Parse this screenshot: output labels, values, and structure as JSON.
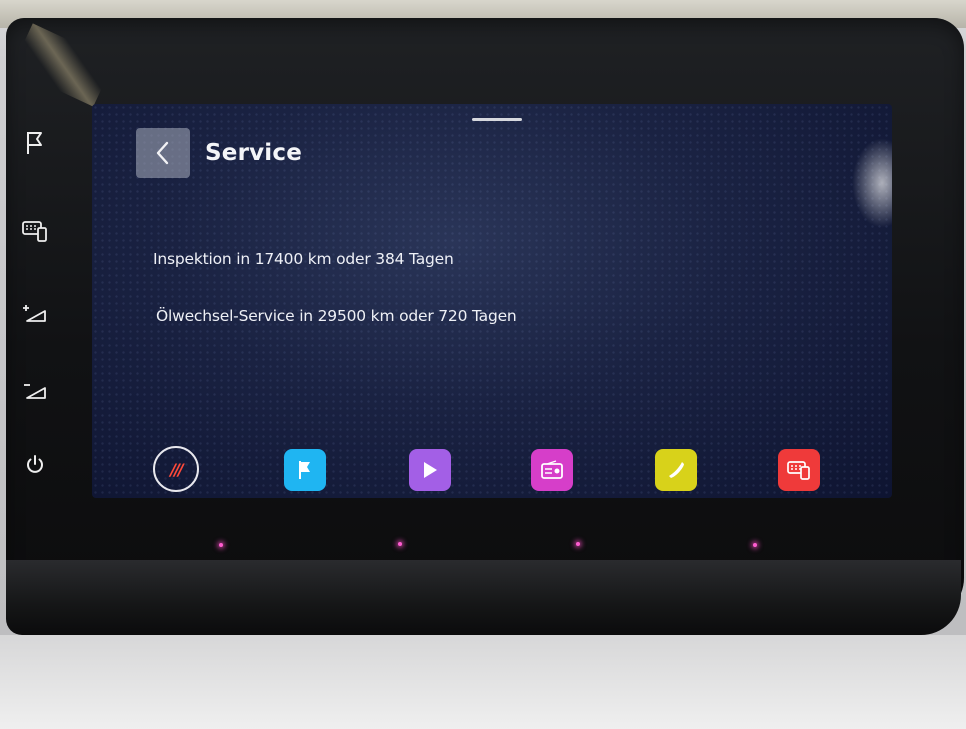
{
  "header": {
    "title": "Service"
  },
  "service_lines": [
    "Inspektion in 17400 km oder 384 Tagen",
    "Ölwechsel-Service in 29500 km oder 720 Tagen"
  ],
  "dock": {
    "home_label": "///",
    "items": [
      {
        "icon": "flag-icon",
        "color": "#1fb5f2"
      },
      {
        "icon": "play-icon",
        "color": "#a35fe6"
      },
      {
        "icon": "radio-icon",
        "color": "#d63ec9"
      },
      {
        "icon": "phone-icon",
        "color": "#d8d21a"
      },
      {
        "icon": "car-phone-icon",
        "color": "#ef3a3a"
      }
    ]
  },
  "side_buttons": [
    "flag-icon",
    "car-phone-icon",
    "volume-up-icon",
    "volume-down-icon",
    "power-icon"
  ]
}
